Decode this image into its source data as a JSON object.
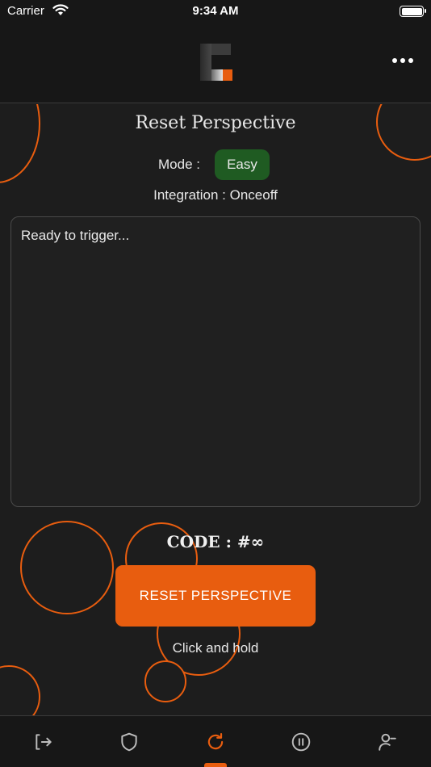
{
  "status_bar": {
    "carrier": "Carrier",
    "time": "9:34 AM"
  },
  "header": {
    "logo_icon": "brand-logo-c",
    "menu_icon": "more-horizontal-icon"
  },
  "main": {
    "title": "Reset Perspective",
    "mode_label": "Mode :",
    "mode_value": "Easy",
    "integration": "Integration : Onceoff",
    "log_text": "Ready to trigger...",
    "code": "CODE : #∞",
    "action_button": "RESET PERSPECTIVE",
    "hint": "Click and hold"
  },
  "tabs": [
    {
      "icon": "log-in-icon",
      "active": false
    },
    {
      "icon": "shield-icon",
      "active": false
    },
    {
      "icon": "refresh-icon",
      "active": true
    },
    {
      "icon": "pause-circle-icon",
      "active": false
    },
    {
      "icon": "user-minus-icon",
      "active": false
    }
  ],
  "colors": {
    "accent": "#e85d0f",
    "badge": "#1f5b22",
    "background": "#1d1d1d",
    "bar": "#171717"
  }
}
